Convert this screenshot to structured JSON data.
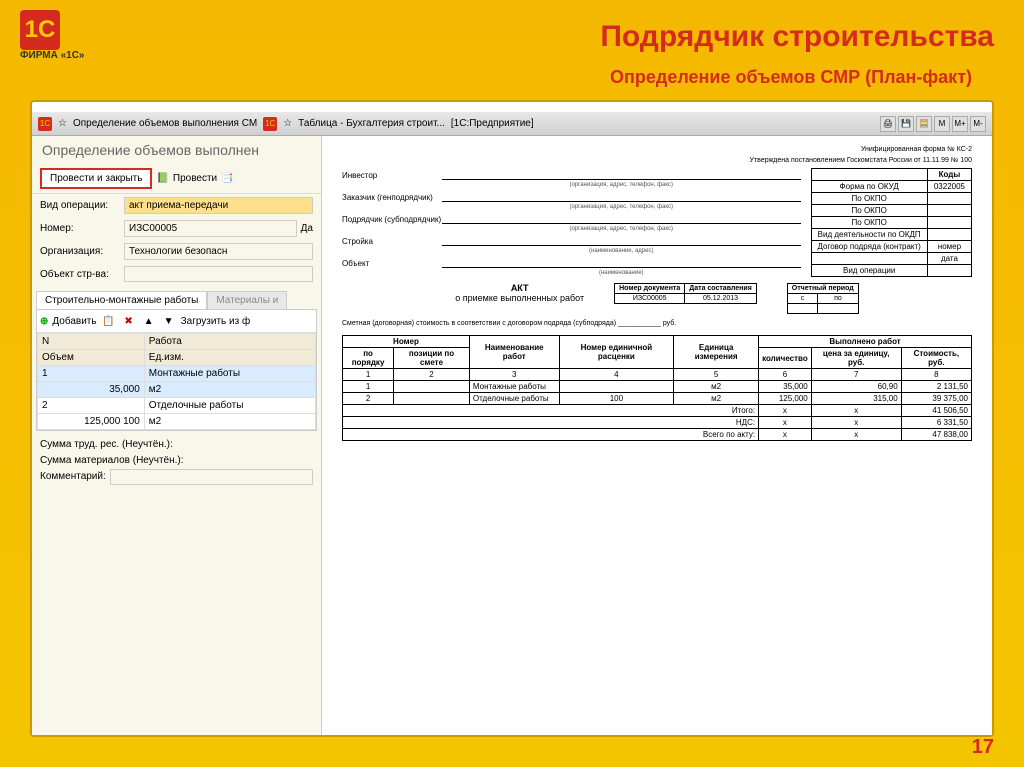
{
  "logo_brand": "ФИРМА «1С»",
  "page_title": "Подрядчик строительства",
  "subtitle": "Определение объемов СМР (План-факт)",
  "titlebar": {
    "app_name": "Определение объемов выполнения СМ",
    "doc_name": "Таблица - Бухгалтерия строит...",
    "mode": "[1С:Предприятие]"
  },
  "panel_title": "Определение объемов выполнен",
  "buttons": {
    "post_close": "Провести и закрыть",
    "post": "Провести",
    "add": "Добавить",
    "load": "Загрузить из ф"
  },
  "form": {
    "op_type_label": "Вид операции:",
    "op_type_value": "акт приема-передачи",
    "number_label": "Номер:",
    "number_value": "ИЗС00005",
    "date_label": "Да",
    "org_label": "Организация:",
    "org_value": "Технологии безопасн",
    "obj_label": "Объект стр-ва:"
  },
  "tabs": {
    "tab1": "Строительно-монтажные работы",
    "tab2": "Материалы и"
  },
  "grid": {
    "col_n": "N",
    "col_work": "Работа",
    "col_vol": "Объем",
    "col_unit": "Ед.изм.",
    "row1_n": "1",
    "row1_work": "Монтажные работы",
    "row1_vol": "35,000",
    "row1_unit": "м2",
    "row2_n": "2",
    "row2_work": "Отделочные работы",
    "row2_vol": "125,000",
    "row2_vol2": "100",
    "row2_unit": "м2"
  },
  "bottom": {
    "sum_trud": "Сумма труд. рес. (Неучтён.):",
    "sum_mat": "Сумма материалов (Неучтён.):",
    "comment": "Комментарий:"
  },
  "print": {
    "header1": "Унифицированная форма № КС-2",
    "header2": "Утверждена постановлением Госкомстата России от 11.11.99 № 100",
    "kody": "Коды",
    "okud": "Форма по ОКУД",
    "okud_val": "0322005",
    "okpo": "По ОКПО",
    "okdp": "Вид деятельности по ОКДП",
    "dogovor": "Договор подряда (контракт)",
    "nomer": "номер",
    "data": "дата",
    "vid_op": "Вид операции",
    "investor": "Инвестор",
    "zakazchik": "Заказчик (генподрядчик)",
    "podryadchik": "Подрядчик (субподрядчик)",
    "stroika": "Стройка",
    "obekt": "Объект",
    "sub_org": "(организация, адрес, телефон, факс)",
    "sub_name": "(наименование, адрес)",
    "sub_name2": "(наименование)",
    "akt": "АКТ",
    "akt_sub": "о приемке выполненных работ",
    "mini_n": "Номер документа",
    "mini_d": "Дата составления",
    "mini_n_val": "ИЗС00005",
    "mini_d_val": "05.12.2013",
    "period": "Отчетный период",
    "period_s": "с",
    "period_po": "по",
    "smeta": "Сметная (договорная) стоимость в соответствии с договором подряда (субподряда)",
    "rub": "руб.",
    "th_nomer": "Номер",
    "th_po_por": "по порядку",
    "th_poz": "позиции по смете",
    "th_naim": "Наименование работ",
    "th_ed_ras": "Номер единичной расценки",
    "th_ed_izm": "Единица измерения",
    "th_vyp": "Выполнено работ",
    "th_kol": "количество",
    "th_cena": "цена за единицу, руб.",
    "th_stoim": "Стоимость, руб.",
    "c1": "1",
    "c2": "2",
    "c3": "3",
    "c4": "4",
    "c5": "5",
    "c6": "6",
    "c7": "7",
    "c8": "8",
    "r1_naim": "Монтажные работы",
    "r1_ed": "м2",
    "r1_kol": "35,000",
    "r1_cena": "60,90",
    "r1_st": "2 131,50",
    "r2_naim": "Отделочные работы",
    "r2_v4": "100",
    "r2_ed": "м2",
    "r2_kol": "125,000",
    "r2_cena": "315,00",
    "r2_st": "39 375,00",
    "itogo": "Итого:",
    "itogo_v": "41 506,50",
    "nds": "НДС:",
    "nds_v": "6 331,50",
    "vsego": "Всего по акту:",
    "vsego_v": "47 838,00",
    "x": "х"
  },
  "page_number": "17",
  "chart_data": {
    "type": "table",
    "title": "АКТ о приемке выполненных работ (КС-2)",
    "columns": [
      "по порядку",
      "позиции по смете",
      "Наименование работ",
      "Номер единичной расценки",
      "Единица измерения",
      "количество",
      "цена за единицу, руб.",
      "Стоимость, руб."
    ],
    "rows": [
      [
        1,
        "",
        "Монтажные работы",
        "",
        "м2",
        35000,
        60.9,
        2131.5
      ],
      [
        2,
        "",
        "Отделочные работы",
        100,
        "м2",
        125000,
        315.0,
        39375.0
      ]
    ],
    "totals": {
      "Итого": 41506.5,
      "НДС": 6331.5,
      "Всего по акту": 47838.0
    }
  }
}
